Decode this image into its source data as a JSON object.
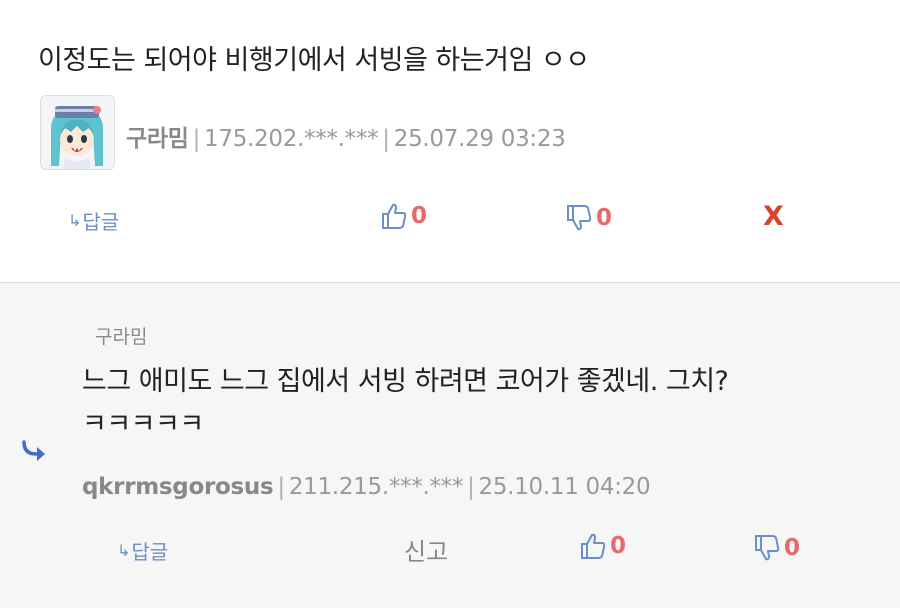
{
  "comment": {
    "text": "이정도는 되어야 비행기에서 서빙을 하는거임 ㅇㅇ",
    "nickname": "구라밈",
    "ip": "175.202.***.***",
    "date": "25.07.29 03:23",
    "reply_label": "답글",
    "likes": "0",
    "dislikes": "0",
    "delete_label": "X"
  },
  "reply": {
    "target_nickname": "구라밈",
    "text_line1": "느그 애미도 느그 집에서 서빙 하려면 코어가 좋겠네. 그치?",
    "text_line2": "ㅋㅋㅋㅋㅋ",
    "nickname": "qkrrmsgorosus",
    "ip": "211.215.***.***",
    "date": "25.10.11 04:20",
    "reply_label": "답글",
    "report_label": "신고",
    "likes": "0",
    "dislikes": "0"
  },
  "colors": {
    "accent_blue": "#6c8fc6",
    "count_red": "#e66a6a",
    "delete_red": "#d8412f",
    "reply_bg": "#f6f6f6"
  },
  "icons": {
    "reply_arrow": "reply-arrow-icon",
    "thumbs_up": "thumbs-up-icon",
    "thumbs_down": "thumbs-down-icon",
    "reply_indicator": "reply-indicator-icon"
  }
}
